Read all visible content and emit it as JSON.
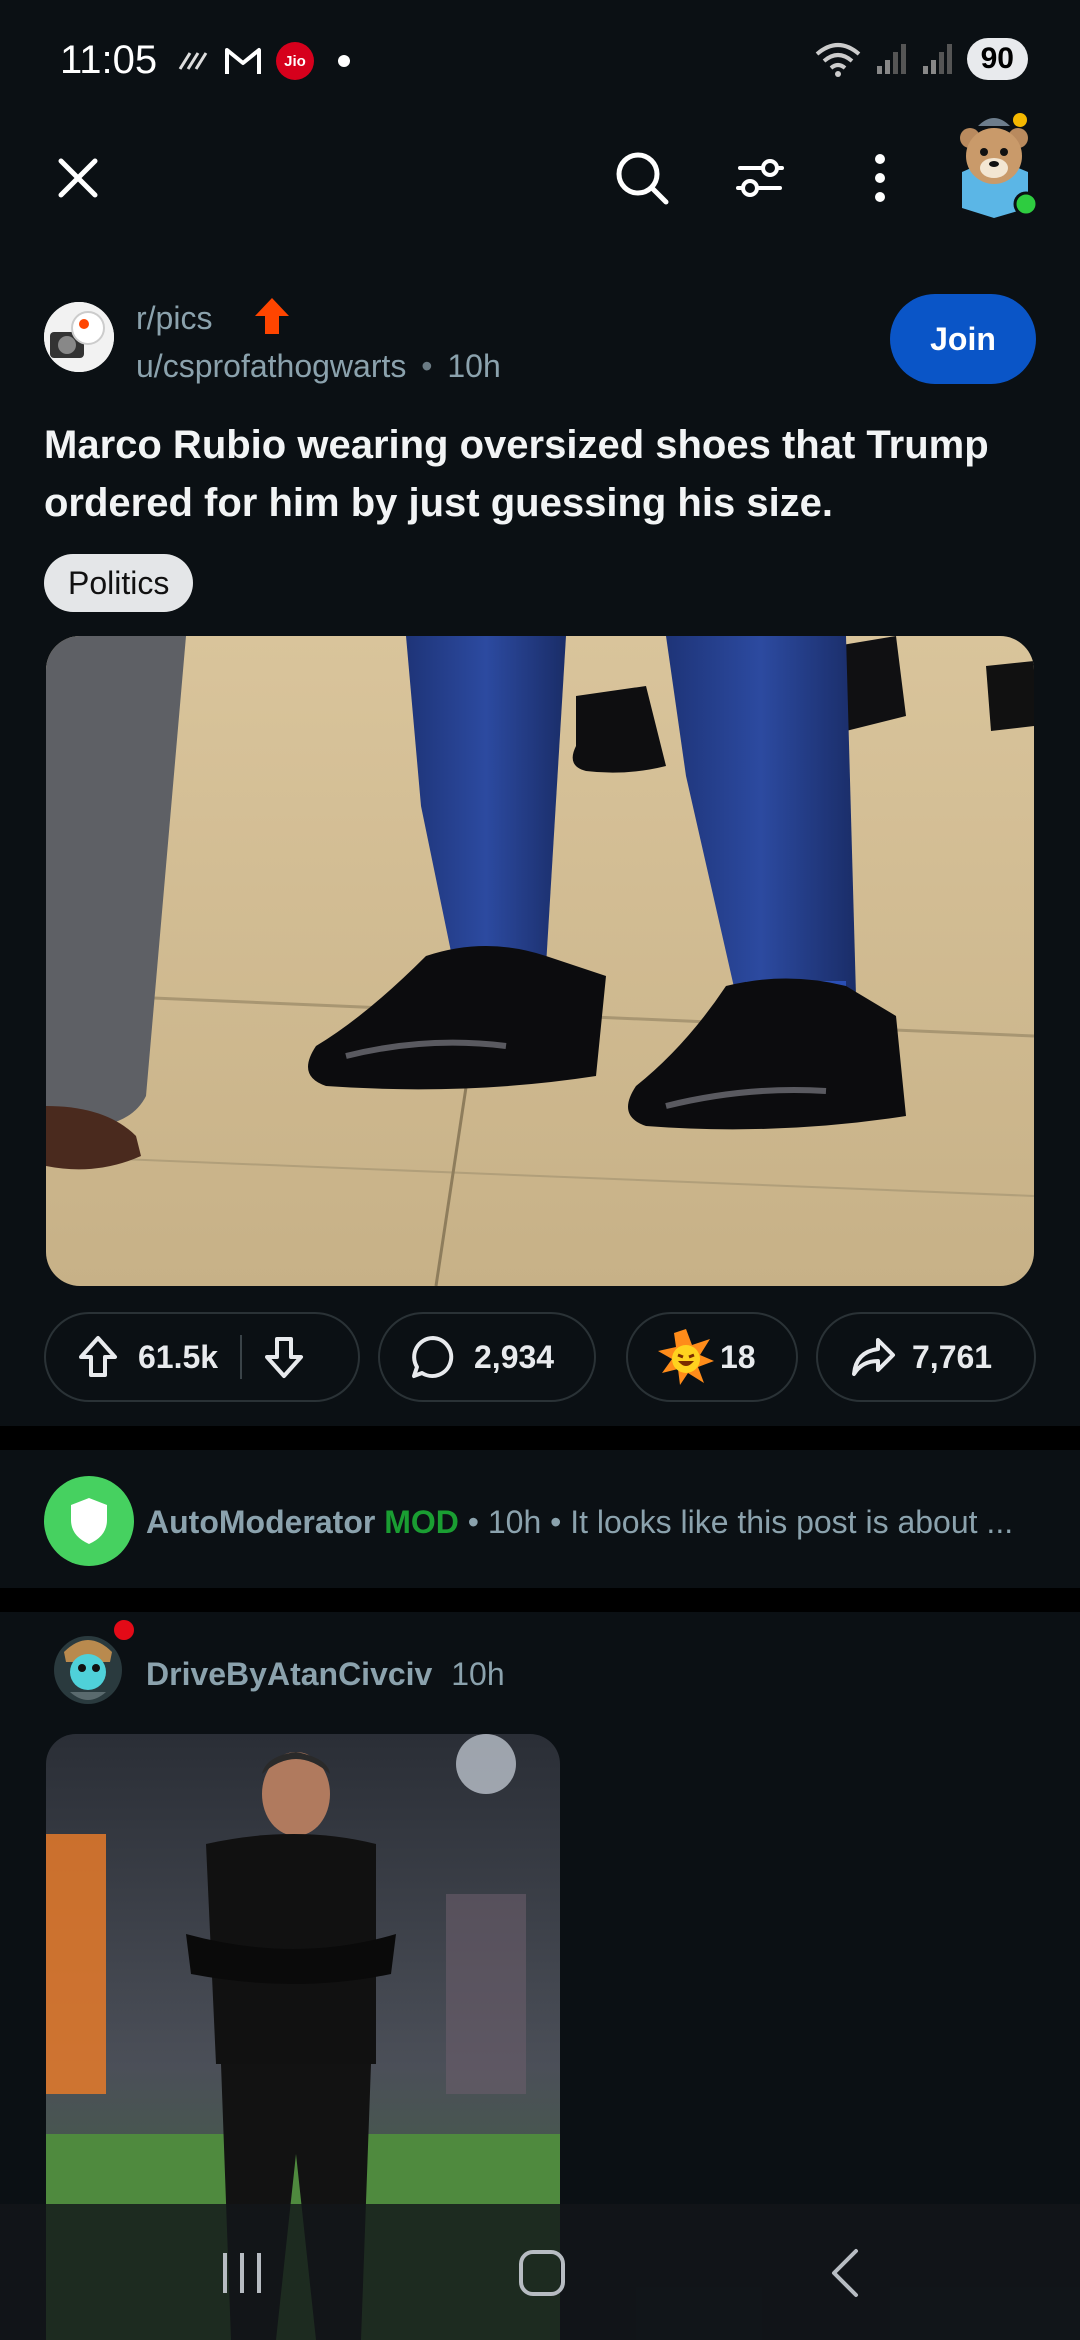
{
  "status_bar": {
    "time": "11:05",
    "carrier_badge": "Jio",
    "battery": "90",
    "signal_label": "5"
  },
  "top_bar": {
    "icons": [
      "close-icon",
      "search-icon",
      "filter-icon",
      "more-options-icon",
      "user-avatar"
    ]
  },
  "post": {
    "subreddit": "r/pics",
    "author": "u/csprofathogwarts",
    "separator": "•",
    "age": "10h",
    "join_label": "Join",
    "title": "Marco Rubio wearing oversized shoes that Trump ordered for him by just guessing his size.",
    "flair": "Politics",
    "upvotes": "61.5k",
    "comments": "2,934",
    "awards": "18",
    "shares": "7,761"
  },
  "automod": {
    "name": "AutoModerator",
    "badge": "MOD",
    "age": "• 10h •",
    "preview": "It looks like this post is about ..."
  },
  "comment": {
    "user": "DriveByAtanCivciv",
    "age": "10h"
  },
  "colors": {
    "background": "#0b1014",
    "join_button": "#0a55c7",
    "mod_green": "#1a9e32",
    "upvote_orange": "#ff4500",
    "automod_avatar": "#46d160"
  }
}
